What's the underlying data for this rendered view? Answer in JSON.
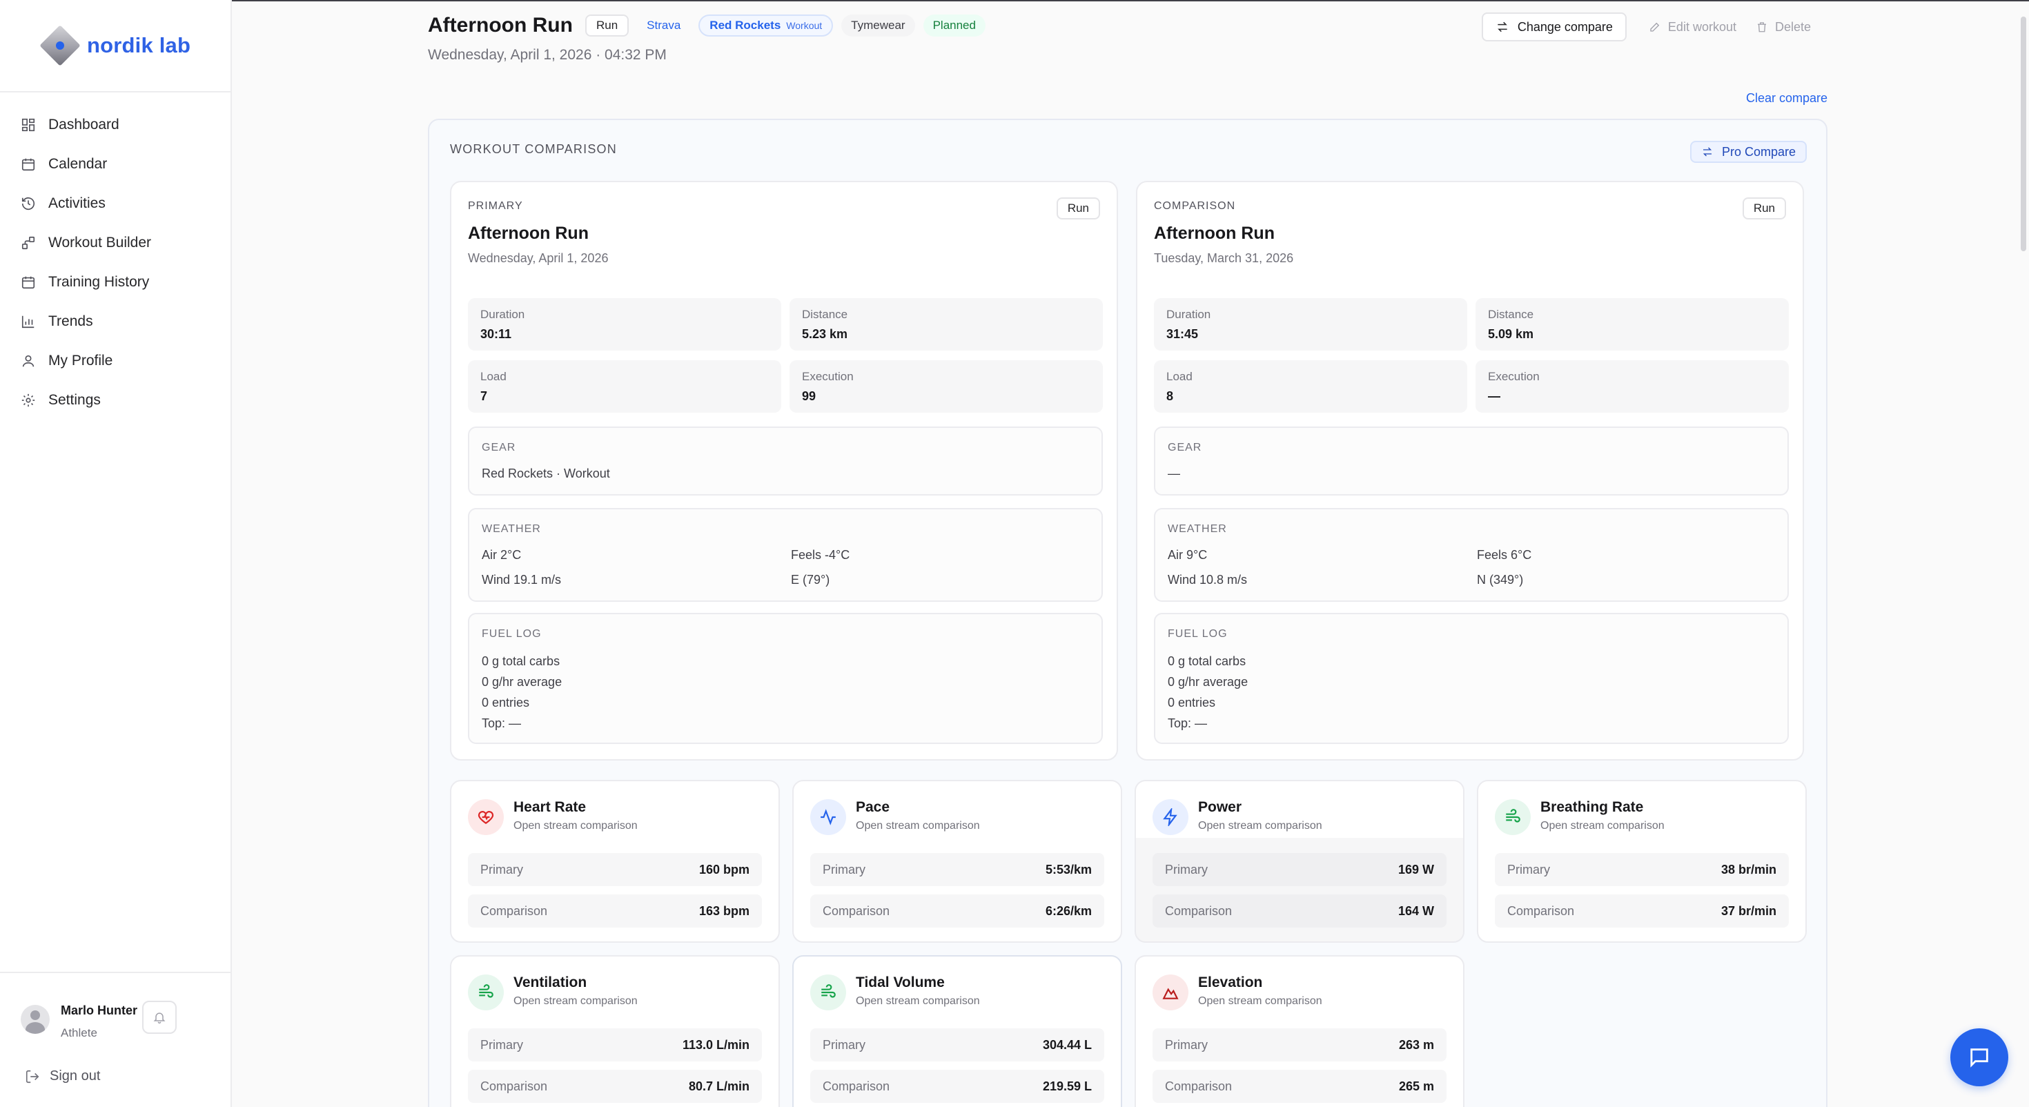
{
  "brand": {
    "name": "nordik lab"
  },
  "nav": {
    "items": [
      {
        "label": "Dashboard",
        "icon": "dashboard-icon"
      },
      {
        "label": "Calendar",
        "icon": "calendar-icon"
      },
      {
        "label": "Activities",
        "icon": "history-icon"
      },
      {
        "label": "Workout Builder",
        "icon": "workflow-icon"
      },
      {
        "label": "Training History",
        "icon": "calendar-icon"
      },
      {
        "label": "Trends",
        "icon": "bar-chart-icon"
      },
      {
        "label": "My Profile",
        "icon": "user-icon"
      },
      {
        "label": "Settings",
        "icon": "gear-icon"
      }
    ]
  },
  "user": {
    "name": "Marlo Hunter",
    "role": "Athlete",
    "signout": "Sign out"
  },
  "header": {
    "title": "Afternoon Run",
    "tags": {
      "sport": "Run",
      "source": "Strava",
      "gear": "Red Rockets",
      "gear_sub": "Workout",
      "brand": "Tymewear",
      "status": "Planned"
    },
    "date": "Wednesday, April 1, 2026 · 04:32 PM",
    "actions": {
      "change_compare": "Change compare",
      "edit": "Edit workout",
      "delete": "Delete"
    },
    "clear_compare": "Clear compare"
  },
  "comparison": {
    "title": "WORKOUT COMPARISON",
    "pro_compare": "Pro Compare",
    "primary": {
      "kicker": "PRIMARY",
      "badge": "Run",
      "title": "Afternoon Run",
      "date": "Wednesday, April 1, 2026",
      "stats": {
        "duration_label": "Duration",
        "duration": "30:11",
        "distance_label": "Distance",
        "distance": "5.23 km",
        "load_label": "Load",
        "load": "7",
        "execution_label": "Execution",
        "execution": "99"
      },
      "gear": {
        "title": "GEAR",
        "value": "Red Rockets · Workout"
      },
      "weather": {
        "title": "WEATHER",
        "air": "Air 2°C",
        "feels": "Feels -4°C",
        "wind": "Wind 19.1 m/s",
        "direction": "E (79°)"
      },
      "fuel": {
        "title": "FUEL LOG",
        "carbs": "0 g total carbs",
        "average": "0 g/hr average",
        "entries": "0 entries",
        "top": "Top: —"
      }
    },
    "secondary": {
      "kicker": "COMPARISON",
      "badge": "Run",
      "title": "Afternoon Run",
      "date": "Tuesday, March 31, 2026",
      "stats": {
        "duration_label": "Duration",
        "duration": "31:45",
        "distance_label": "Distance",
        "distance": "5.09 km",
        "load_label": "Load",
        "load": "8",
        "execution_label": "Execution",
        "execution": "—"
      },
      "gear": {
        "title": "GEAR",
        "value": "—"
      },
      "weather": {
        "title": "WEATHER",
        "air": "Air 9°C",
        "feels": "Feels 6°C",
        "wind": "Wind 10.8 m/s",
        "direction": "N (349°)"
      },
      "fuel": {
        "title": "FUEL LOG",
        "carbs": "0 g total carbs",
        "average": "0 g/hr average",
        "entries": "0 entries",
        "top": "Top: —"
      }
    }
  },
  "metrics": {
    "subtitle": "Open stream comparison",
    "primary_label": "Primary",
    "comparison_label": "Comparison",
    "heart_rate": {
      "title": "Heart Rate",
      "primary": "160 bpm",
      "comparison": "163 bpm",
      "icon": "heart-pulse-icon",
      "color": "#dc2626"
    },
    "pace": {
      "title": "Pace",
      "primary": "5:53/km",
      "comparison": "6:26/km",
      "icon": "activity-icon",
      "color": "#2563eb"
    },
    "power": {
      "title": "Power",
      "primary": "169 W",
      "comparison": "164 W",
      "icon": "zap-icon",
      "color": "#2563eb"
    },
    "breathing_rate": {
      "title": "Breathing Rate",
      "primary": "38 br/min",
      "comparison": "37 br/min",
      "icon": "wind-icon",
      "color": "#16a34a"
    },
    "ventilation": {
      "title": "Ventilation",
      "primary": "113.0 L/min",
      "comparison": "80.7 L/min",
      "icon": "wind-icon",
      "color": "#16a34a"
    },
    "tidal_volume": {
      "title": "Tidal Volume",
      "primary": "304.44 L",
      "comparison": "219.59 L",
      "icon": "wind-icon",
      "color": "#16a34a"
    },
    "elevation": {
      "title": "Elevation",
      "primary": "263 m",
      "comparison": "265 m",
      "icon": "mountain-icon",
      "color": "#b91c1c"
    }
  }
}
